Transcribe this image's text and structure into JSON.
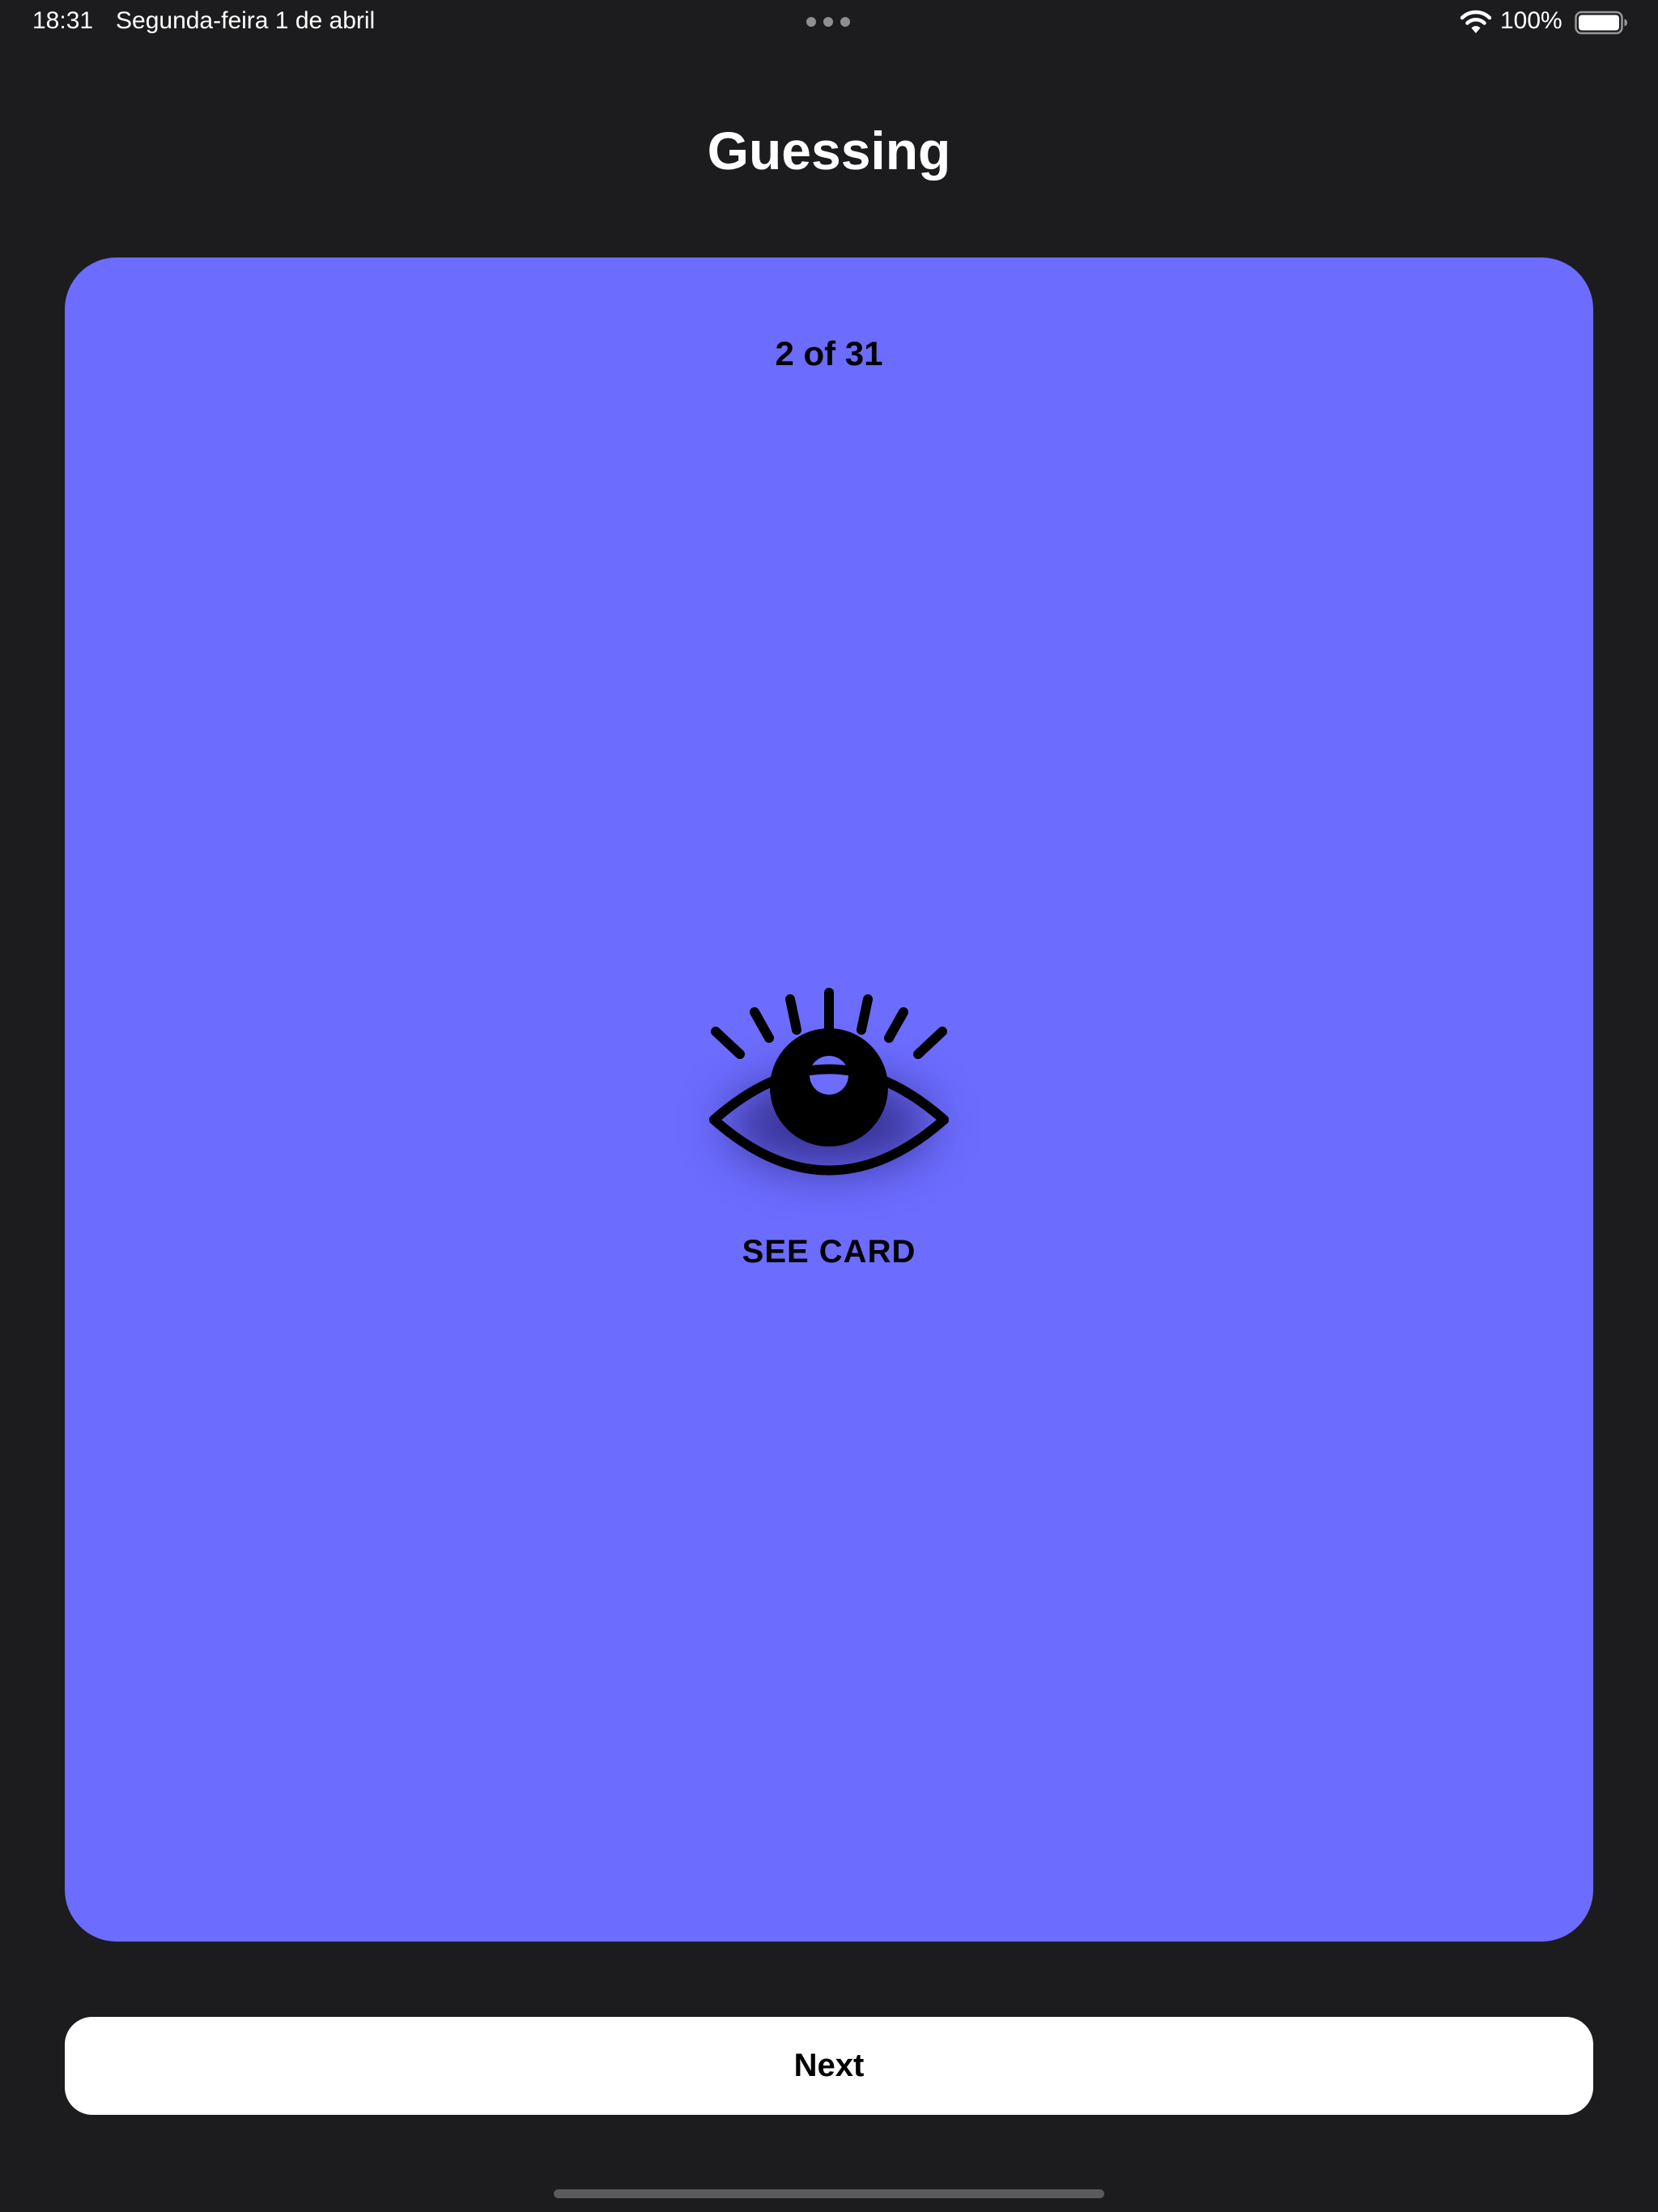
{
  "status_bar": {
    "time": "18:31",
    "date": "Segunda-feira 1 de abril",
    "battery_percent": "100%",
    "battery_level": 1.0,
    "icons": [
      "multitasking-dots-icon",
      "wifi-icon",
      "battery-icon"
    ]
  },
  "page": {
    "title": "Guessing"
  },
  "card": {
    "counter": "2 of 31",
    "icon": "eye-icon",
    "action_label": "SEE CARD",
    "background_color": "#6c6cff"
  },
  "next_button": {
    "label": "Next"
  },
  "colors": {
    "background": "#1c1c1e",
    "card": "#6c6cff",
    "button": "#ffffff",
    "text_on_dark": "#ffffff",
    "text_on_light": "#000000"
  }
}
